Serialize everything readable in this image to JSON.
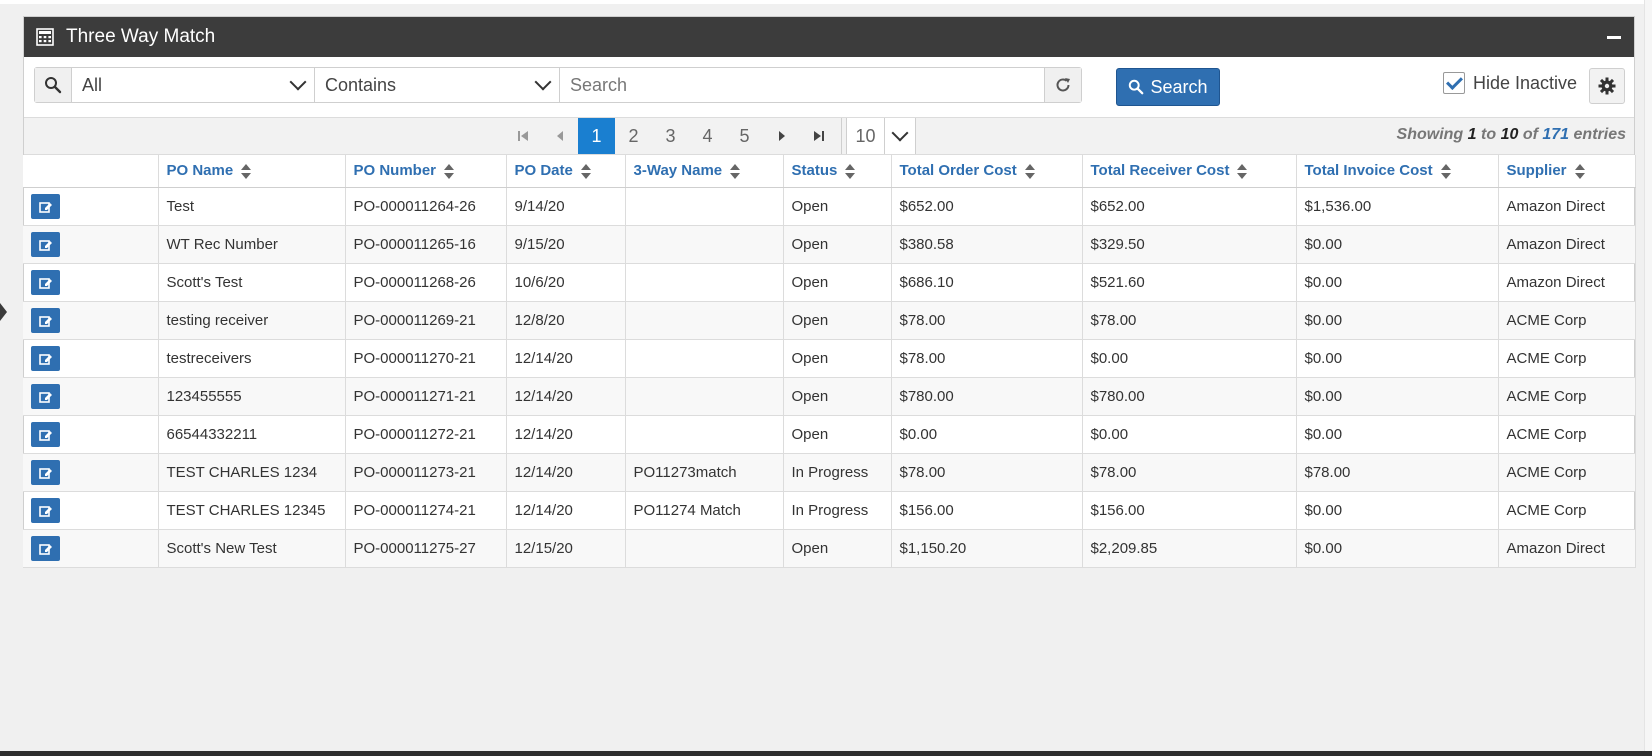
{
  "panel": {
    "title": "Three Way Match"
  },
  "filter": {
    "field_selected": "All",
    "operator_selected": "Contains",
    "search_placeholder": "Search",
    "search_button_label": "Search",
    "hide_inactive_label": "Hide Inactive",
    "hide_inactive_checked": true
  },
  "pagination": {
    "pages": [
      "1",
      "2",
      "3",
      "4",
      "5"
    ],
    "current_page": "1",
    "page_size": "10",
    "showing_prefix": "Showing",
    "showing_from": "1",
    "showing_to_word": "to",
    "showing_to": "10",
    "showing_of_word": "of",
    "showing_total": "171",
    "showing_suffix": "entries"
  },
  "table": {
    "columns": [
      "PO Name",
      "PO Number",
      "PO Date",
      "3-Way Name",
      "Status",
      "Total Order Cost",
      "Total Receiver Cost",
      "Total Invoice Cost",
      "Supplier"
    ],
    "rows": [
      [
        "Test",
        "PO-000011264-26",
        "9/14/20",
        "",
        "Open",
        "$652.00",
        "$652.00",
        "$1,536.00",
        "Amazon Direct"
      ],
      [
        "WT Rec Number",
        "PO-000011265-16",
        "9/15/20",
        "",
        "Open",
        "$380.58",
        "$329.50",
        "$0.00",
        "Amazon Direct"
      ],
      [
        "Scott's Test",
        "PO-000011268-26",
        "10/6/20",
        "",
        "Open",
        "$686.10",
        "$521.60",
        "$0.00",
        "Amazon Direct"
      ],
      [
        "testing receiver",
        "PO-000011269-21",
        "12/8/20",
        "",
        "Open",
        "$78.00",
        "$78.00",
        "$0.00",
        "ACME Corp"
      ],
      [
        "testreceivers",
        "PO-000011270-21",
        "12/14/20",
        "",
        "Open",
        "$78.00",
        "$0.00",
        "$0.00",
        "ACME Corp"
      ],
      [
        "123455555",
        "PO-000011271-21",
        "12/14/20",
        "",
        "Open",
        "$780.00",
        "$780.00",
        "$0.00",
        "ACME Corp"
      ],
      [
        "66544332211",
        "PO-000011272-21",
        "12/14/20",
        "",
        "Open",
        "$0.00",
        "$0.00",
        "$0.00",
        "ACME Corp"
      ],
      [
        "TEST CHARLES 1234",
        "PO-000011273-21",
        "12/14/20",
        "PO11273match",
        "In Progress",
        "$78.00",
        "$78.00",
        "$78.00",
        "ACME Corp"
      ],
      [
        "TEST CHARLES 12345",
        "PO-000011274-21",
        "12/14/20",
        "PO11274 Match",
        "In Progress",
        "$156.00",
        "$156.00",
        "$0.00",
        "ACME Corp"
      ],
      [
        "Scott's New Test",
        "PO-000011275-27",
        "12/15/20",
        "",
        "Open",
        "$1,150.20",
        "$2,209.85",
        "$0.00",
        "Amazon Direct"
      ]
    ]
  },
  "colors": {
    "accent": "#2f6fb1",
    "header_bg": "#3c3c3c",
    "active_page": "#1a7fd0"
  },
  "icons": {
    "header": "calculator-icon",
    "collapse": "minus-icon",
    "search": "search-icon",
    "refresh": "refresh-icon",
    "settings": "gear-icon",
    "edit": "edit-icon"
  }
}
